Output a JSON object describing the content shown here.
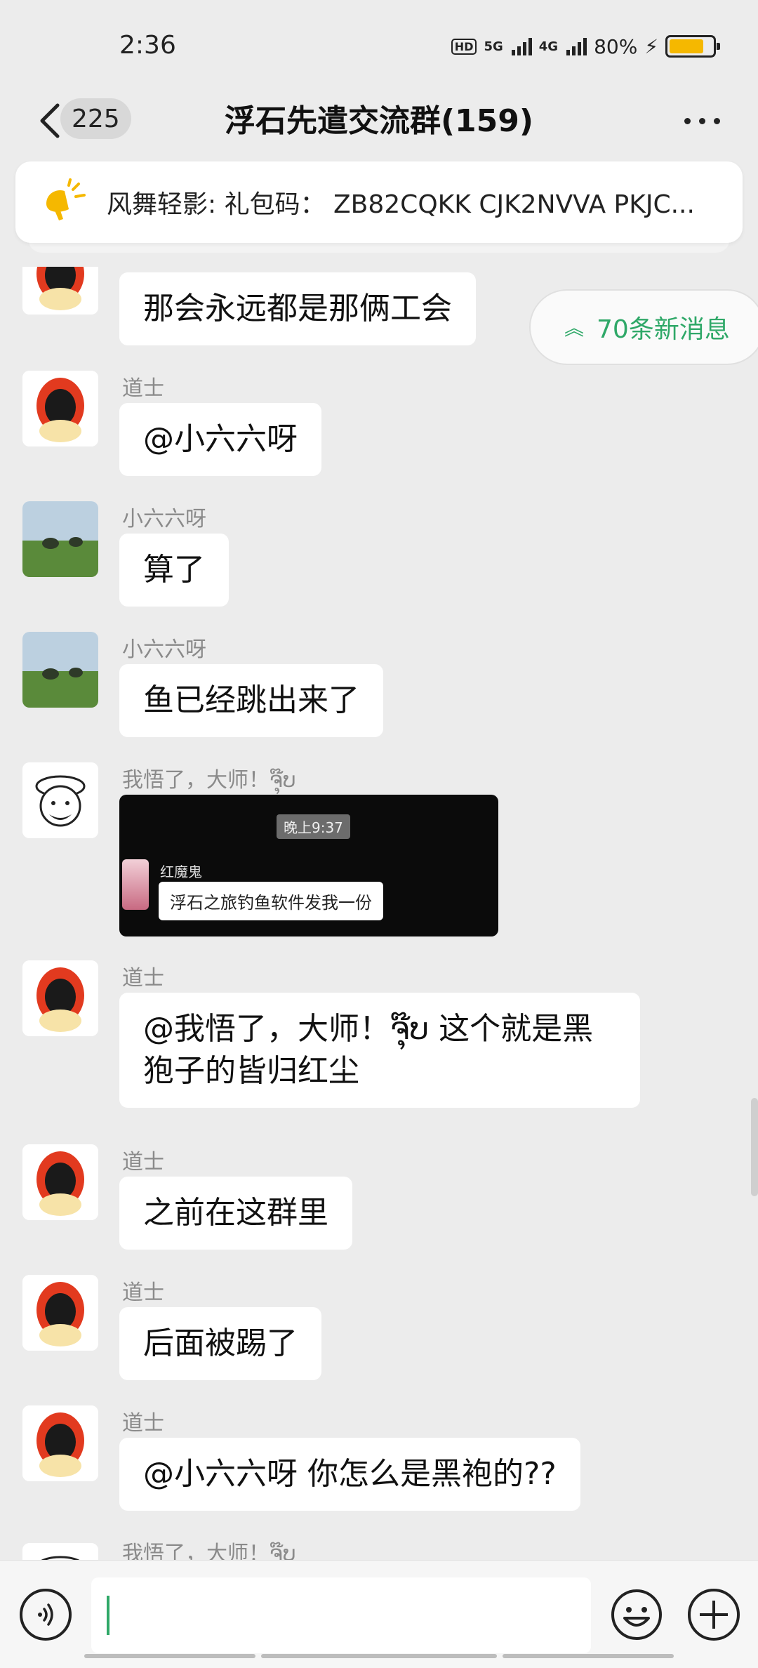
{
  "status_bar": {
    "time": "2:36",
    "hd_label": "HD",
    "network_5g": "5G",
    "network_4g": "4G",
    "battery_text": "80%",
    "battery_level": 0.8,
    "battery_color": "#f5b800"
  },
  "header": {
    "back_icon": "chevron-left-icon",
    "unread_count": "225",
    "title": "浮石先遣交流群(159)",
    "more_icon": "more-dots-icon"
  },
  "announcement": {
    "icon": "megaphone-icon",
    "text": "风舞轻影: 礼包码： ZB82CQKK CJK2NVVA PKJC..."
  },
  "new_messages": {
    "label": "70条新消息",
    "color": "#2fa868"
  },
  "messages": [
    {
      "sender": "",
      "text": "那会永远都是那俩工会"
    },
    {
      "sender": "道士",
      "text": "@小六六呀"
    },
    {
      "sender": "小六六呀",
      "text": "算了"
    },
    {
      "sender": "小六六呀",
      "text": "鱼已经跳出来了"
    },
    {
      "sender": "我悟了，大师！ຈຸ໊ບ",
      "image": {
        "time_label": "晚上9:37",
        "name": "红魔鬼",
        "quote": "浮石之旅钓鱼软件发我一份"
      }
    },
    {
      "sender": "道士",
      "text_line1": "@我悟了，大师！ຈຸ໊ບ 这个就是黑",
      "text_line2": "狍子的皆归红尘"
    },
    {
      "sender": "道士",
      "text": "之前在这群里"
    },
    {
      "sender": "道士",
      "text": "后面被踢了"
    },
    {
      "sender": "道士",
      "text": "@小六六呀  你怎么是黑袍的??"
    },
    {
      "sender": "我悟了，大师！ຈຸ໊ບ",
      "text": ""
    }
  ],
  "input_bar": {
    "voice_icon": "voice-icon",
    "input_value": "",
    "emoji_icon": "emoji-icon",
    "plus_icon": "plus-icon"
  }
}
